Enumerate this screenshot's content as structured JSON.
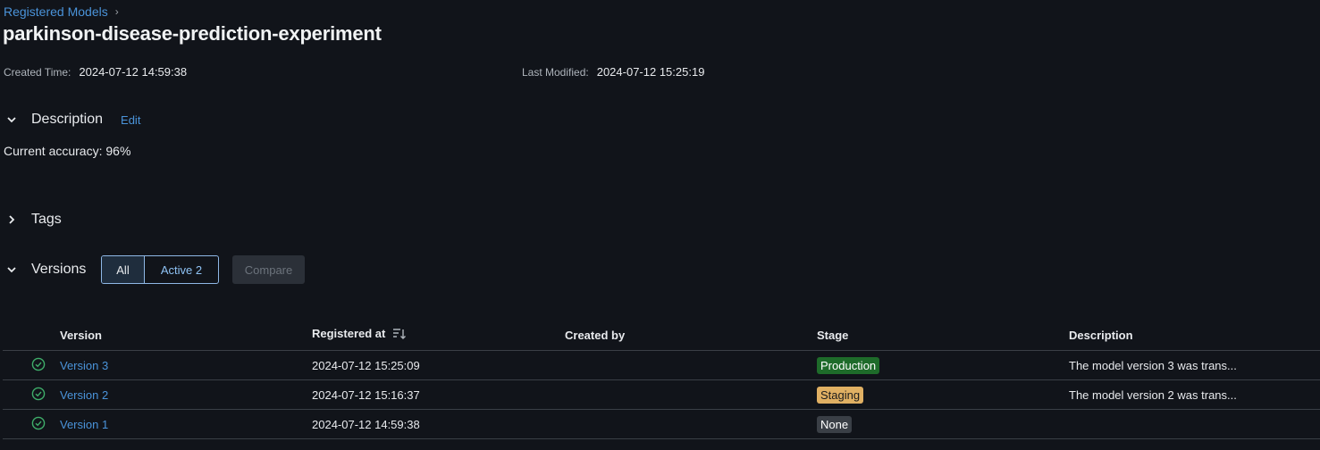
{
  "breadcrumb": {
    "label": "Registered Models",
    "separator": "›"
  },
  "model": {
    "name": "parkinson-disease-prediction-experiment"
  },
  "meta": {
    "created_label": "Created Time:",
    "created_value": "2024-07-12 14:59:38",
    "modified_label": "Last Modified:",
    "modified_value": "2024-07-12 15:25:19"
  },
  "description": {
    "heading": "Description",
    "edit_label": "Edit",
    "text": "Current accuracy: 96%"
  },
  "tags": {
    "heading": "Tags"
  },
  "versions": {
    "heading": "Versions",
    "filter_all": "All",
    "filter_active": "Active 2",
    "compare_label": "Compare",
    "columns": [
      "Version",
      "Registered at",
      "Created by",
      "Stage",
      "Description"
    ],
    "rows": [
      {
        "version": "Version 3",
        "registered_at": "2024-07-12 15:25:09",
        "created_by": "",
        "stage": "Production",
        "description": "The model version 3 was trans..."
      },
      {
        "version": "Version 2",
        "registered_at": "2024-07-12 15:16:37",
        "created_by": "",
        "stage": "Staging",
        "description": "The model version 2 was trans..."
      },
      {
        "version": "Version 1",
        "registered_at": "2024-07-12 14:59:38",
        "created_by": "",
        "stage": "None",
        "description": ""
      }
    ]
  },
  "colors": {
    "stage_production_bg": "#1e6b2a",
    "stage_production_fg": "#ffffff",
    "stage_staging_bg": "#e0b063",
    "stage_staging_fg": "#1b1b1b",
    "stage_none_bg": "#3a3f46",
    "stage_none_fg": "#ffffff",
    "status_ok": "#3fae6a"
  }
}
